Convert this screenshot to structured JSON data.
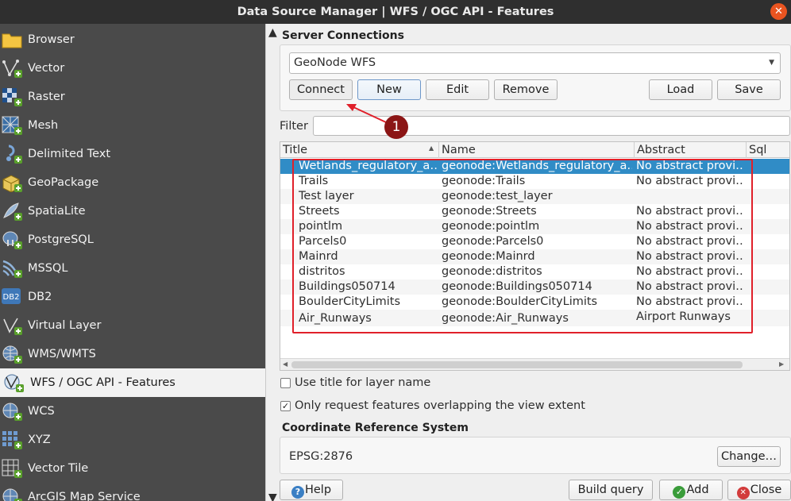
{
  "window": {
    "title": "Data Source Manager | WFS / OGC API - Features",
    "close_glyph": "✕"
  },
  "sidebar": {
    "items": [
      {
        "label": "Browser",
        "icon": "folder-icon"
      },
      {
        "label": "Vector",
        "icon": "vector-icon"
      },
      {
        "label": "Raster",
        "icon": "raster-icon"
      },
      {
        "label": "Mesh",
        "icon": "mesh-icon"
      },
      {
        "label": "Delimited Text",
        "icon": "delimited-text-icon"
      },
      {
        "label": "GeoPackage",
        "icon": "geopackage-icon"
      },
      {
        "label": "SpatiaLite",
        "icon": "spatialite-icon"
      },
      {
        "label": "PostgreSQL",
        "icon": "postgresql-icon"
      },
      {
        "label": "MSSQL",
        "icon": "mssql-icon"
      },
      {
        "label": "DB2",
        "icon": "db2-icon"
      },
      {
        "label": "Virtual Layer",
        "icon": "virtual-layer-icon"
      },
      {
        "label": "WMS/WMTS",
        "icon": "wms-icon"
      },
      {
        "label": "WFS / OGC API - Features",
        "icon": "wfs-icon",
        "active": true
      },
      {
        "label": "WCS",
        "icon": "wcs-icon"
      },
      {
        "label": "XYZ",
        "icon": "xyz-icon"
      },
      {
        "label": "Vector Tile",
        "icon": "vector-tile-icon"
      },
      {
        "label": "ArcGIS Map Service",
        "icon": "arcgis-icon"
      }
    ]
  },
  "server_connections": {
    "heading": "Server Connections",
    "selected": "GeoNode WFS",
    "buttons": {
      "connect": "Connect",
      "new": "New",
      "edit": "Edit",
      "remove": "Remove",
      "load": "Load",
      "save": "Save"
    }
  },
  "filter": {
    "label": "Filter",
    "value": ""
  },
  "annotation": {
    "badge": "1"
  },
  "table": {
    "columns": [
      "Title",
      "Name",
      "Abstract",
      "Sql"
    ],
    "rows": [
      {
        "title": "Wetlands_regulatory_a…",
        "name": "geonode:Wetlands_regulatory_a…",
        "abstract": "No abstract provi…",
        "selected": true
      },
      {
        "title": "Trails",
        "name": "geonode:Trails",
        "abstract": "No abstract provi…"
      },
      {
        "title": "Test layer",
        "name": "geonode:test_layer",
        "abstract": ""
      },
      {
        "title": "Streets",
        "name": "geonode:Streets",
        "abstract": "No abstract provi…"
      },
      {
        "title": "pointlm",
        "name": "geonode:pointlm",
        "abstract": "No abstract provi…"
      },
      {
        "title": "Parcels0",
        "name": "geonode:Parcels0",
        "abstract": "No abstract provi…"
      },
      {
        "title": "Mainrd",
        "name": "geonode:Mainrd",
        "abstract": "No abstract provi…"
      },
      {
        "title": "distritos",
        "name": "geonode:distritos",
        "abstract": "No abstract provi…"
      },
      {
        "title": "Buildings050714",
        "name": "geonode:Buildings050714",
        "abstract": "No abstract provi…"
      },
      {
        "title": "BoulderCityLimits",
        "name": "geonode:BoulderCityLimits",
        "abstract": "No abstract provi…"
      },
      {
        "title": "Air_Runways",
        "name": "geonode:Air_Runways",
        "abstract": "Airport Runways"
      }
    ]
  },
  "options": {
    "use_title": {
      "label": "Use title for layer name",
      "checked": false
    },
    "only_request": {
      "label": "Only request features overlapping the view extent",
      "checked": true
    }
  },
  "crs": {
    "heading": "Coordinate Reference System",
    "value": "EPSG:2876",
    "change_button": "Change…"
  },
  "footer": {
    "help": "Help",
    "build_query": "Build query",
    "add": "Add",
    "close": "Close"
  },
  "colors": {
    "accent": "#e95420",
    "selection": "#308cc6",
    "annotation_red": "#e0202a",
    "badge": "#8b1515",
    "sidebar_bg": "#4a4a4a"
  }
}
